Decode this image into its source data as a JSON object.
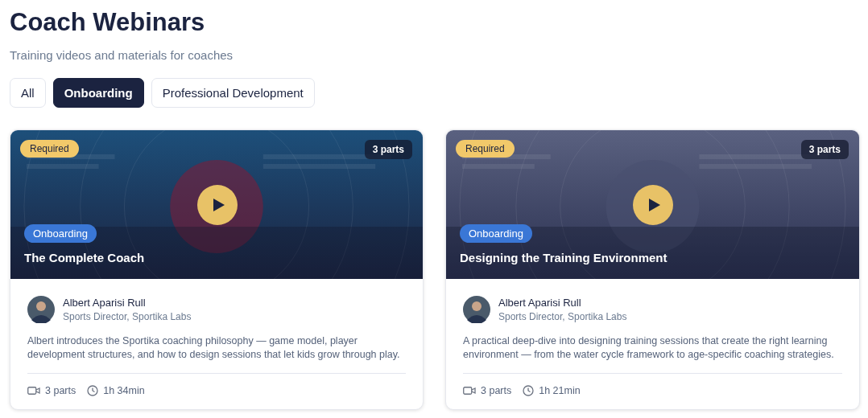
{
  "header": {
    "title": "Coach Webinars",
    "subtitle": "Training videos and materials for coaches"
  },
  "tabs": [
    {
      "label": "All",
      "selected": false
    },
    {
      "label": "Onboarding",
      "selected": true
    },
    {
      "label": "Professional Development",
      "selected": false
    }
  ],
  "webinars": [
    {
      "required_badge": "Required",
      "parts_badge": "3 parts",
      "category": "Onboarding",
      "title": "The Complete Coach",
      "presenter": {
        "name": "Albert Aparisi Rull",
        "role": "Sports Director, Sportika Labs"
      },
      "description": "Albert introduces the Sportika coaching philosophy — game model, player development structures, and how to design sessions that let kids grow through play.",
      "parts": "3 parts",
      "duration": "1h 34min"
    },
    {
      "required_badge": "Required",
      "parts_badge": "3 parts",
      "category": "Onboarding",
      "title": "Designing the Training Environment",
      "presenter": {
        "name": "Albert Aparisi Rull",
        "role": "Sports Director, Sportika Labs"
      },
      "description": "A practical deep-dive into designing training sessions that create the right learning environment — from the water cycle framework to age-specific coaching strategies.",
      "parts": "3 parts",
      "duration": "1h 21min"
    }
  ]
}
